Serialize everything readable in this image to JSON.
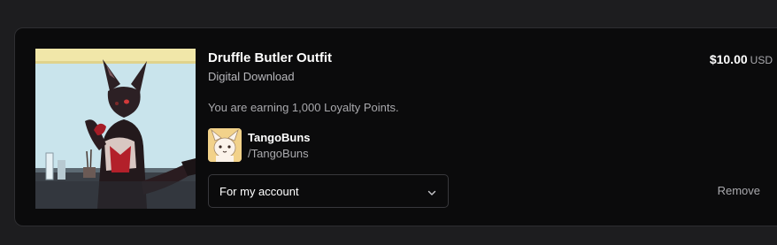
{
  "cart_item": {
    "title": "Druffle Butler Outfit",
    "type": "Digital Download",
    "loyalty_text": "You are earning 1,000 Loyalty Points.",
    "price": {
      "amount": "$10.00",
      "currency": "USD"
    },
    "seller": {
      "name": "TangoBuns",
      "handle": "/TangoBuns"
    },
    "recipient_select": {
      "selected": "For my account"
    },
    "remove_label": "Remove"
  },
  "colors": {
    "background": "#1d1d1f",
    "card": "#0b0b0c",
    "border": "#2e2e31",
    "text_primary": "#ffffff",
    "text_secondary": "#a9a9ad"
  },
  "icons": {
    "select_chevron": "chevron-down-icon"
  }
}
